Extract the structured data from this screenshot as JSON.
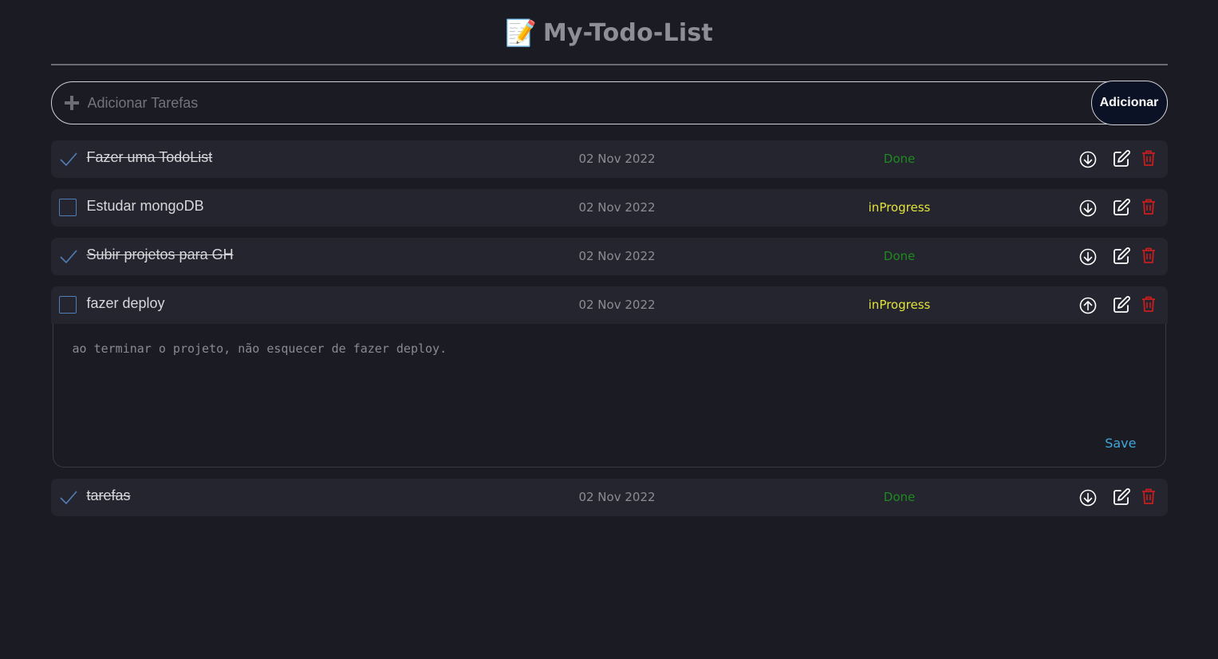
{
  "header": {
    "emoji": "📝",
    "title": "My-Todo-List"
  },
  "add": {
    "placeholder": "Adicionar Tarefas",
    "button_label": "Adicionar"
  },
  "colors": {
    "done": "#1f8a1f",
    "in_progress": "#e2e23c",
    "delete": "#c81e1e",
    "save": "#3fa8d8"
  },
  "tasks": [
    {
      "title": "Fazer uma TodoList",
      "date": "02 Nov 2022",
      "status": "Done",
      "completed": true,
      "expanded": false
    },
    {
      "title": "Estudar mongoDB",
      "date": "02 Nov 2022",
      "status": "inProgress",
      "completed": false,
      "expanded": false
    },
    {
      "title": "Subir projetos para GH",
      "date": "02 Nov 2022",
      "status": "Done",
      "completed": true,
      "expanded": false
    },
    {
      "title": "fazer deploy",
      "date": "02 Nov 2022",
      "status": "inProgress",
      "completed": false,
      "expanded": true,
      "description": "ao terminar o projeto, não esquecer de fazer deploy.",
      "save_label": "Save"
    },
    {
      "title": "tarefas",
      "date": "02 Nov 2022",
      "status": "Done",
      "completed": true,
      "expanded": false
    }
  ]
}
